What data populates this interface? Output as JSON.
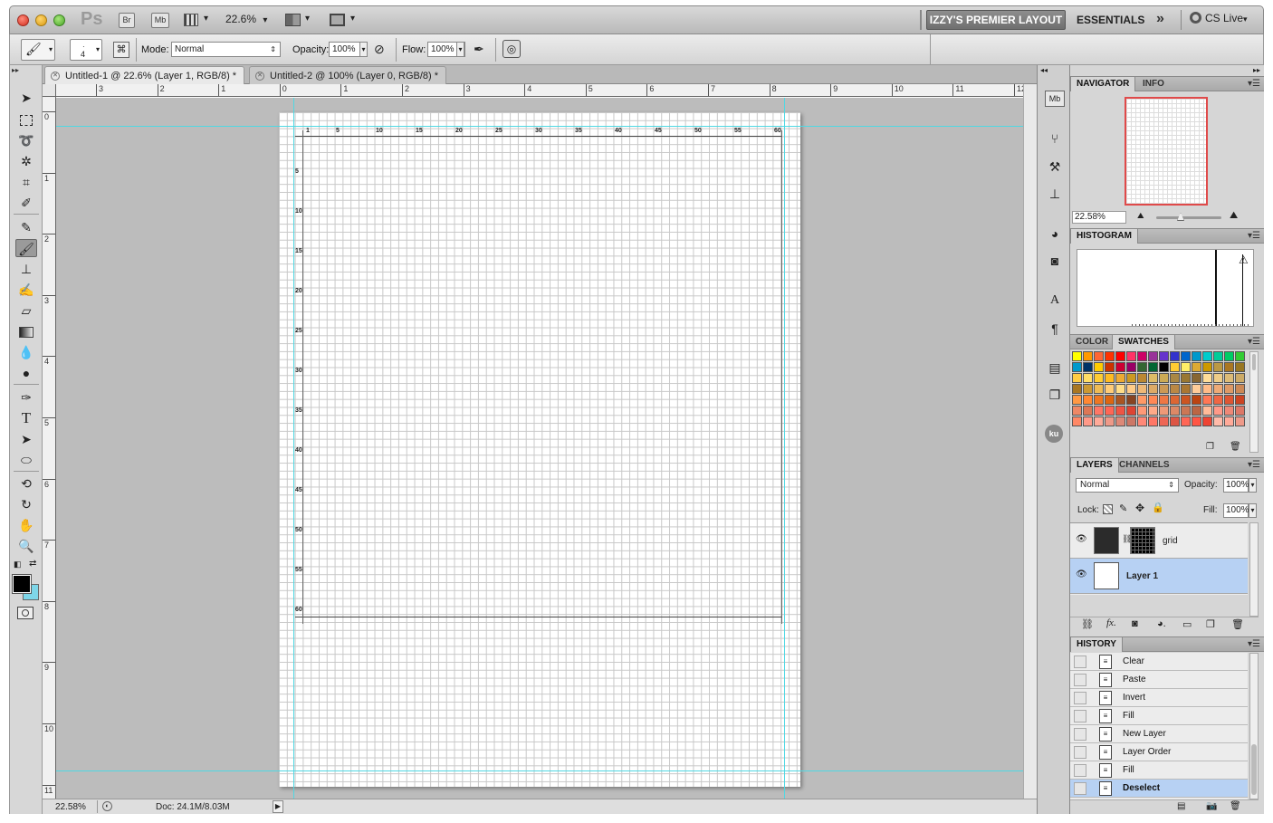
{
  "appbar": {
    "app_logo": "Ps",
    "bridge": "Br",
    "minibridge": "Mb",
    "zoom": "22.6%",
    "zoom_caret": "▾",
    "workspace_active": "IZZY'S PREMIER LAYOUT",
    "workspace_essentials": "ESSENTIALS",
    "more": "»",
    "cs_live": "CS Live"
  },
  "options": {
    "brush_size": "4",
    "mode_label": "Mode:",
    "mode_value": "Normal",
    "opacity_label": "Opacity:",
    "opacity_value": "100%",
    "flow_label": "Flow:",
    "flow_value": "100%"
  },
  "tabs": [
    {
      "label": "Untitled-1 @ 22.6% (Layer 1, RGB/8) *"
    },
    {
      "label": "Untitled-2 @ 100% (Layer 0, RGB/8) *"
    }
  ],
  "ruler_h": [
    "3",
    "2",
    "1",
    "0",
    "1",
    "2",
    "3",
    "4",
    "5",
    "6",
    "7",
    "8",
    "9",
    "10",
    "11",
    "12"
  ],
  "ruler_v": [
    "0",
    "1",
    "2",
    "3",
    "4",
    "5",
    "6",
    "7",
    "8",
    "9",
    "10",
    "11"
  ],
  "grid_top": [
    "1",
    "5",
    "10",
    "15",
    "20",
    "25",
    "30",
    "35",
    "40",
    "45",
    "50",
    "55",
    "60"
  ],
  "grid_left": [
    "5",
    "10",
    "15",
    "20",
    "25",
    "30",
    "35",
    "40",
    "45",
    "50",
    "55",
    "60"
  ],
  "status": {
    "zoom": "22.58%",
    "doc": "Doc: 24.1M/8.03M"
  },
  "navigator": {
    "tab1": "NAVIGATOR",
    "tab2": "INFO",
    "zoom": "22.58%"
  },
  "histogram": {
    "tab1": "HISTOGRAM"
  },
  "swatches": {
    "tab1": "COLOR",
    "tab2": "SWATCHES",
    "rows": [
      [
        "#ffff00",
        "#ff9900",
        "#ff6633",
        "#ff3300",
        "#ff0000",
        "#ff3366",
        "#cc0066",
        "#993399",
        "#6633cc",
        "#3333cc",
        "#0066cc",
        "#0099cc",
        "#00cccc",
        "#00cc99",
        "#00cc66",
        "#33cc33",
        "#99cc33",
        "#cc3399"
      ],
      [
        "#0099cc",
        "#003366",
        "#ffcc00",
        "#cc3300",
        "#cc0033",
        "#990066",
        "#336633",
        "#006633",
        "#000000",
        "#ffcc33",
        "#ffee66",
        "#ddaa33",
        "#cc9900",
        "#bb9944",
        "#aa7722",
        "#997722",
        "#886611",
        "#664411"
      ],
      [
        "#ffcc44",
        "#ffdd66",
        "#ffcc33",
        "#ffbb22",
        "#eeaa33",
        "#cc9922",
        "#bb8833",
        "#ddbb66",
        "#ccaa55",
        "#aa8844",
        "#997733",
        "#886633",
        "#ffdd99",
        "#eecc88",
        "#ddbb77",
        "#ccaa66",
        "#bb9955",
        "#aa8844"
      ],
      [
        "#aa7722",
        "#cc9933",
        "#eebb55",
        "#ffcc77",
        "#ffdd88",
        "#ffcc88",
        "#eeb877",
        "#ddaa66",
        "#cc9955",
        "#bb8844",
        "#aa7733",
        "#ffcc99",
        "#ffbb88",
        "#eeaa77",
        "#dd9966",
        "#cc8855",
        "#bb7744",
        "#aa6633"
      ],
      [
        "#ff9944",
        "#ff8833",
        "#ee7722",
        "#dd6611",
        "#aa5522",
        "#884422",
        "#ff9966",
        "#ff8855",
        "#ee7744",
        "#dd6633",
        "#cc5522",
        "#bb4411",
        "#ff7755",
        "#ee6644",
        "#dd5533",
        "#cc4422",
        "#ff6644",
        "#ee5533"
      ],
      [
        "#ee8866",
        "#dd7755",
        "#ff7766",
        "#ff6655",
        "#ee5544",
        "#dd4433",
        "#ff9977",
        "#ffaa88",
        "#ee9977",
        "#dd8866",
        "#cc7755",
        "#bb6644",
        "#ffbb99",
        "#ff9988",
        "#ee8877",
        "#dd7766",
        "#cc6655",
        "#ff7766"
      ],
      [
        "#ff8866",
        "#ff9988",
        "#ffaa99",
        "#ee9988",
        "#dd8877",
        "#cc7766",
        "#ff8877",
        "#ff7766",
        "#ee6655",
        "#dd5544",
        "#ff6655",
        "#ff5544",
        "#ee4433",
        "#ffbbaa",
        "#ffaa99",
        "#ee9988",
        "#ff9988",
        "#ffccbb"
      ]
    ]
  },
  "layers": {
    "tab1": "LAYERS",
    "tab2": "CHANNELS",
    "blend": "Normal",
    "opacity_label": "Opacity:",
    "opacity": "100%",
    "lock_label": "Lock:",
    "fill_label": "Fill:",
    "fill": "100%",
    "items": [
      {
        "name": "grid"
      },
      {
        "name": "Layer 1"
      }
    ]
  },
  "history": {
    "tab1": "HISTORY",
    "items": [
      {
        "label": "Clear"
      },
      {
        "label": "Paste"
      },
      {
        "label": "Invert"
      },
      {
        "label": "Fill"
      },
      {
        "label": "New Layer"
      },
      {
        "label": "Layer Order"
      },
      {
        "label": "Fill"
      },
      {
        "label": "Deselect"
      }
    ]
  },
  "icons": {
    "pref": "Mb",
    "ku": "ku"
  }
}
